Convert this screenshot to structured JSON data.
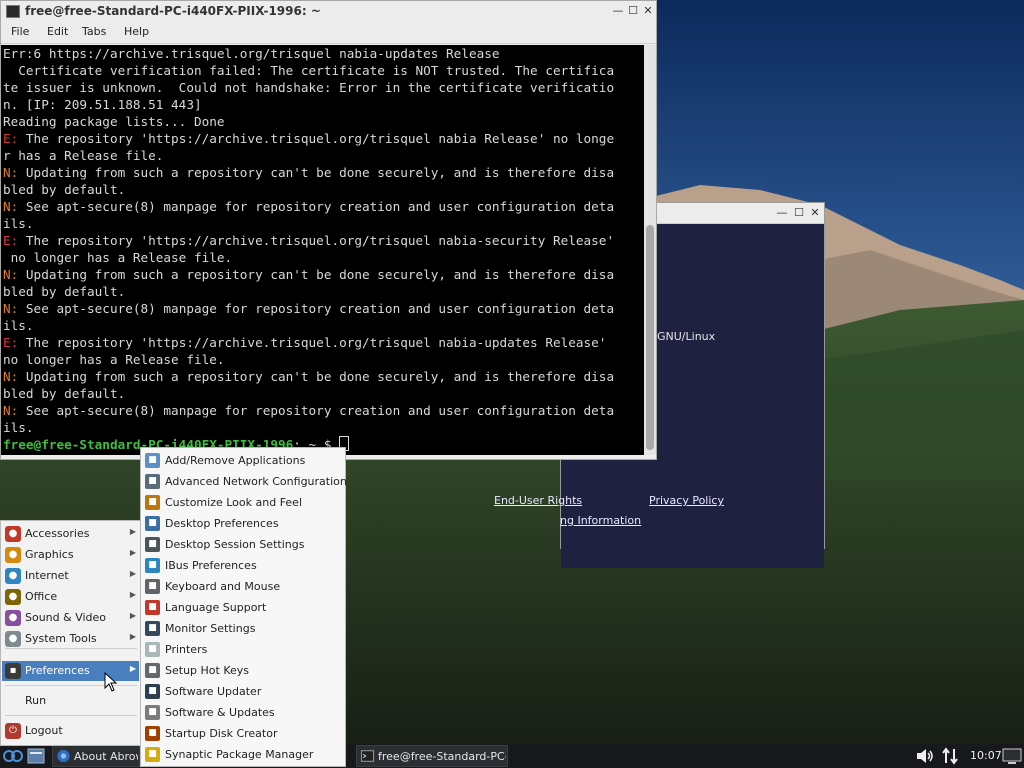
{
  "terminal": {
    "title": "free@free-Standard-PC-i440FX-PIIX-1996: ~",
    "menu": [
      "File",
      "Edit",
      "Tabs",
      "Help"
    ],
    "controls": {
      "minimize": "—",
      "maximize": "☐",
      "close": "✕"
    },
    "lines": [
      {
        "prefix": "",
        "text": "Err:6 https://archive.trisquel.org/trisquel nabia-updates Release"
      },
      {
        "prefix": "",
        "text": "  Certificate verification failed: The certificate is NOT trusted. The certifica"
      },
      {
        "prefix": "",
        "text": "te issuer is unknown.  Could not handshake: Error in the certificate verificatio"
      },
      {
        "prefix": "",
        "text": "n. [IP: 209.51.188.51 443]"
      },
      {
        "prefix": "",
        "text": "Reading package lists... Done"
      },
      {
        "prefix": "E:",
        "text": " The repository 'https://archive.trisquel.org/trisquel nabia Release' no longe"
      },
      {
        "prefix": "",
        "text": "r has a Release file."
      },
      {
        "prefix": "N:",
        "text": " Updating from such a repository can't be done securely, and is therefore disa"
      },
      {
        "prefix": "",
        "text": "bled by default."
      },
      {
        "prefix": "N:",
        "text": " See apt-secure(8) manpage for repository creation and user configuration deta"
      },
      {
        "prefix": "",
        "text": "ils."
      },
      {
        "prefix": "E:",
        "text": " The repository 'https://archive.trisquel.org/trisquel nabia-security Release'"
      },
      {
        "prefix": "",
        "text": " no longer has a Release file."
      },
      {
        "prefix": "N:",
        "text": " Updating from such a repository can't be done securely, and is therefore disa"
      },
      {
        "prefix": "",
        "text": "bled by default."
      },
      {
        "prefix": "N:",
        "text": " See apt-secure(8) manpage for repository creation and user configuration deta"
      },
      {
        "prefix": "",
        "text": "ils."
      },
      {
        "prefix": "E:",
        "text": " The repository 'https://archive.trisquel.org/trisquel nabia-updates Release'"
      },
      {
        "prefix": "",
        "text": "no longer has a Release file."
      },
      {
        "prefix": "N:",
        "text": " Updating from such a repository can't be done securely, and is therefore disa"
      },
      {
        "prefix": "",
        "text": "bled by default."
      },
      {
        "prefix": "N:",
        "text": " See apt-secure(8) manpage for repository creation and user configuration deta"
      },
      {
        "prefix": "",
        "text": "ils."
      }
    ],
    "prompt": "free@free-Standard-PC-i440FX-PIIX-1996",
    "prompt_suffix": ": ~ $ "
  },
  "about_window": {
    "os_text": "GNU/Linux",
    "links": [
      "ng Information",
      "End-User Rights",
      "Privacy Policy"
    ]
  },
  "start_menu": {
    "items": [
      {
        "label": "Accessories",
        "icon": "accessories-icon",
        "color": "#c0392b",
        "has_sub": true
      },
      {
        "label": "Graphics",
        "icon": "graphics-icon",
        "color": "#d68910",
        "has_sub": true
      },
      {
        "label": "Internet",
        "icon": "internet-icon",
        "color": "#2e86c1",
        "has_sub": true
      },
      {
        "label": "Office",
        "icon": "office-icon",
        "color": "#7d6608",
        "has_sub": true
      },
      {
        "label": "Sound & Video",
        "icon": "sound-video-icon",
        "color": "#884ea0",
        "has_sub": true
      },
      {
        "label": "System Tools",
        "icon": "system-tools-icon",
        "color": "#7f8c8d",
        "has_sub": true
      }
    ],
    "preferences": "Preferences",
    "run": "Run",
    "logout": "Logout"
  },
  "preferences_menu": {
    "items": [
      {
        "label": "Add/Remove Applications",
        "icon": "add-remove-apps-icon",
        "color": "#5d8fc9"
      },
      {
        "label": "Advanced Network Configuration",
        "icon": "network-config-icon",
        "color": "#5a6b7a"
      },
      {
        "label": "Customize Look and Feel",
        "icon": "look-feel-icon",
        "color": "#b9770e"
      },
      {
        "label": "Desktop Preferences",
        "icon": "desktop-prefs-icon",
        "color": "#3a6ea5"
      },
      {
        "label": "Desktop Session Settings",
        "icon": "session-settings-icon",
        "color": "#4d5656"
      },
      {
        "label": "IBus Preferences",
        "icon": "ibus-icon",
        "color": "#2e86c1"
      },
      {
        "label": "Keyboard and Mouse",
        "icon": "keyboard-mouse-icon",
        "color": "#626567"
      },
      {
        "label": "Language Support",
        "icon": "language-icon",
        "color": "#c0392b"
      },
      {
        "label": "Monitor Settings",
        "icon": "monitor-icon",
        "color": "#34495e"
      },
      {
        "label": "Printers",
        "icon": "printer-icon",
        "color": "#aab7b8"
      },
      {
        "label": "Setup Hot Keys",
        "icon": "hotkeys-icon",
        "color": "#616a6b"
      },
      {
        "label": "Software Updater",
        "icon": "software-updater-icon",
        "color": "#2c3e50"
      },
      {
        "label": "Software & Updates",
        "icon": "software-updates-icon",
        "color": "#7b7d7d"
      },
      {
        "label": "Startup Disk Creator",
        "icon": "startup-disk-icon",
        "color": "#a04000"
      },
      {
        "label": "Synaptic Package Manager",
        "icon": "synaptic-icon",
        "color": "#d4ac0d"
      }
    ]
  },
  "taskbar": {
    "about_label": "About Abrowser",
    "terminal_label": "free@free-Standard-PC-i...",
    "clock": "10:07"
  }
}
